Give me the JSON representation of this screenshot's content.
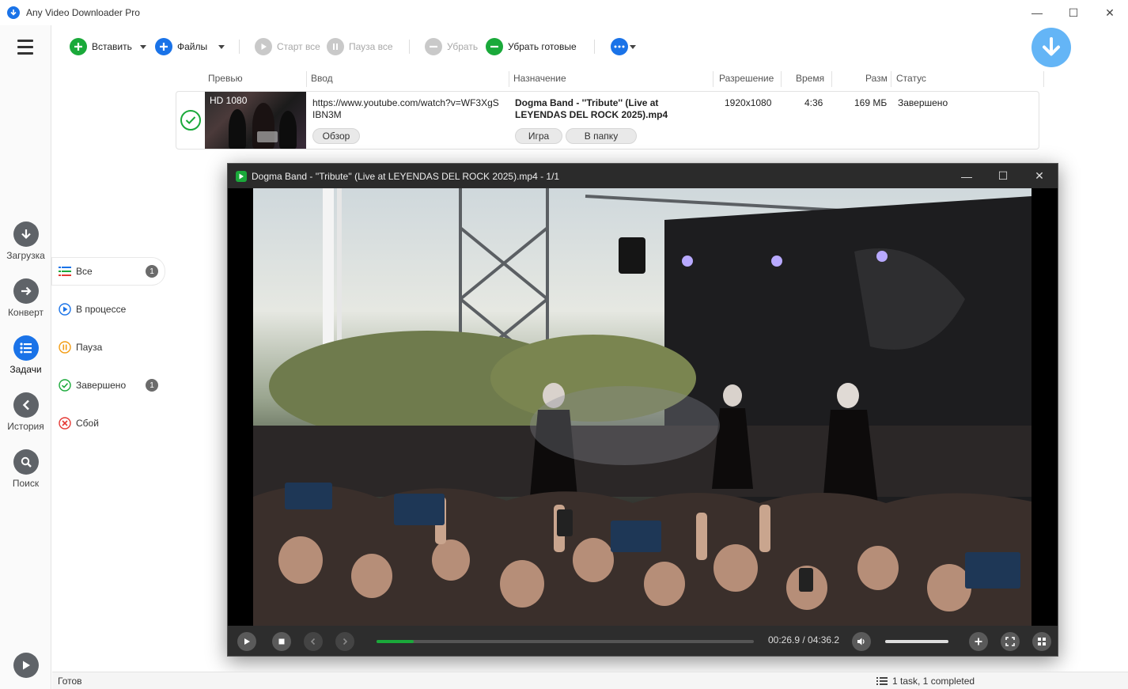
{
  "window": {
    "title": "Any Video Downloader Pro",
    "minimize": "—",
    "maximize": "☐",
    "close": "✕"
  },
  "sidebar": {
    "items": [
      {
        "label": "Загрузка",
        "icon": "download-icon"
      },
      {
        "label": "Конверт",
        "icon": "convert-icon"
      },
      {
        "label": "Задачи",
        "icon": "tasks-icon",
        "active": true
      },
      {
        "label": "История",
        "icon": "history-icon"
      },
      {
        "label": "Поиск",
        "icon": "search-icon"
      }
    ]
  },
  "toolbar": {
    "paste_label": "Вставить",
    "files_label": "Файлы",
    "start_all_label": "Старт все",
    "pause_all_label": "Пауза все",
    "remove_label": "Убрать",
    "remove_done_label": "Убрать готовые"
  },
  "filters": [
    {
      "label": "Все",
      "count": "1",
      "icon": "list-icon",
      "active": true
    },
    {
      "label": "В процессе",
      "count": "",
      "icon": "play-circle-icon"
    },
    {
      "label": "Пауза",
      "count": "",
      "icon": "pause-circle-icon"
    },
    {
      "label": "Завершено",
      "count": "1",
      "icon": "check-circle-icon"
    },
    {
      "label": "Сбой",
      "count": "",
      "icon": "error-circle-icon"
    }
  ],
  "columns": {
    "preview": "Превью",
    "input": "Ввод",
    "destination": "Назначение",
    "resolution": "Разрешение",
    "time": "Время",
    "size": "Разм",
    "status": "Статус"
  },
  "task": {
    "badge": "HD 1080",
    "url_line1": "https://www.youtube.com/watch?v=WF3XgS",
    "url_line2": "IBN3M",
    "browse_label": "Обзор",
    "dest_line1": "Dogma Band - ''Tribute''  (Live at",
    "dest_line2": "LEYENDAS DEL ROCK 2025).mp4",
    "play_label": "Игра",
    "folder_label": "В папку",
    "resolution": "1920x1080",
    "time": "4:36",
    "size": "169 МБ",
    "status": "Завершено"
  },
  "player": {
    "title": "Dogma Band - ''Tribute''  (Live at LEYENDAS DEL ROCK 2025).mp4 - 1/1",
    "timecode": "00:26.9 / 04:36.2",
    "progress": 0.098,
    "volume": 1.0
  },
  "status": {
    "left": "Готов",
    "right": "1 task, 1 completed"
  },
  "colors": {
    "accent_blue": "#1a73e8",
    "accent_green": "#1aa93a",
    "big_download": "#64b5f6"
  }
}
